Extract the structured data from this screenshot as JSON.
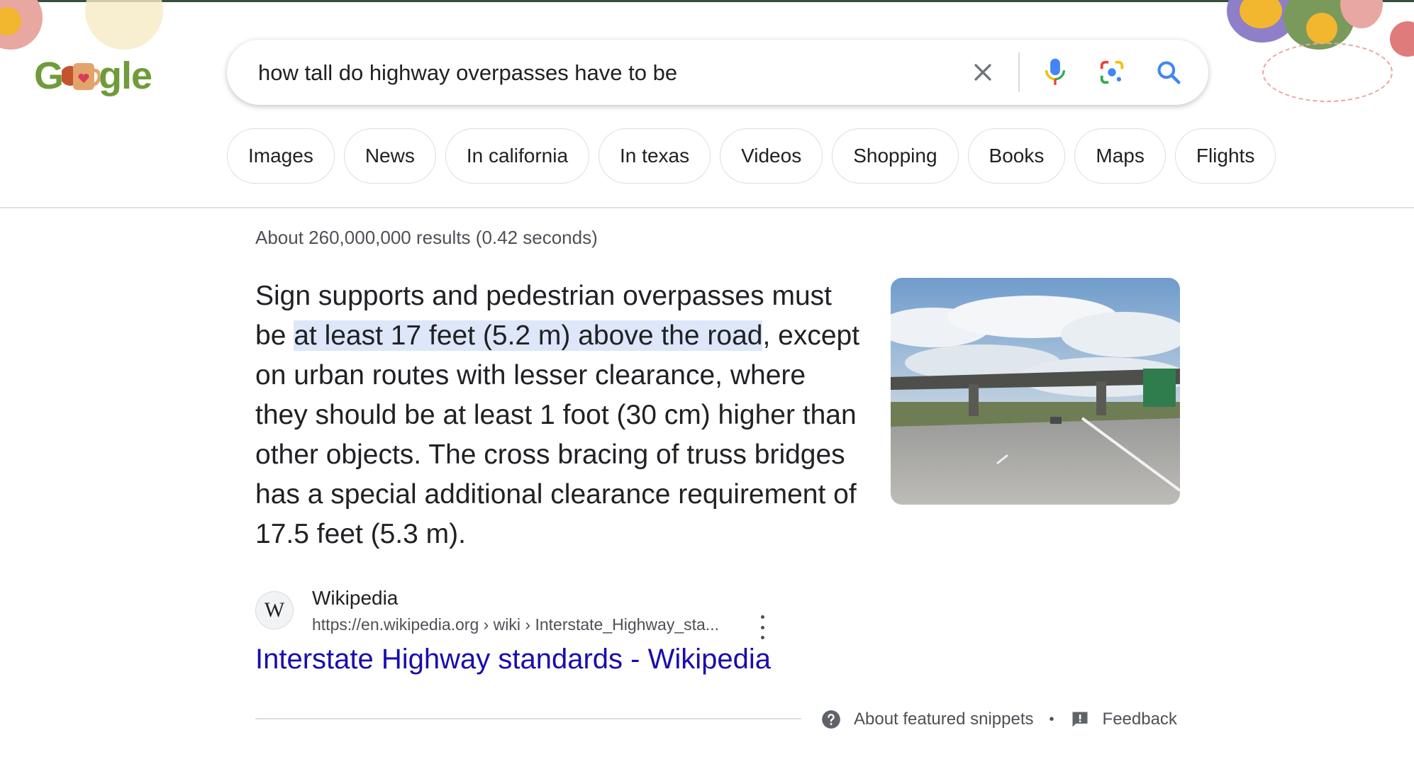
{
  "search": {
    "query": "how tall do highway overpasses have to be"
  },
  "icons": {
    "clear": "close-icon",
    "voice": "microphone-icon",
    "lens": "camera-lens-icon",
    "search": "search-icon",
    "help": "help-circle-icon",
    "feedback": "feedback-icon",
    "more": "more-vert-icon"
  },
  "chips": [
    "Images",
    "News",
    "In california",
    "In texas",
    "Videos",
    "Shopping",
    "Books",
    "Maps",
    "Flights"
  ],
  "results": {
    "stats": "About 260,000,000 results (0.42 seconds)"
  },
  "snippet": {
    "text_before": "Sign supports and pedestrian overpasses must be ",
    "text_highlight": "at least 17 feet (5.2 m) above the road",
    "text_after": ", except on urban routes with lesser clearance, where they should be at least 1 foot (30 cm) higher than other objects. The cross bracing of truss bridges has a special additional clearance requirement of 17.5 feet (5.3 m).",
    "image_alt": "highway overpass"
  },
  "source": {
    "favicon_letter": "W",
    "name": "Wikipedia",
    "url": "https://en.wikipedia.org › wiki › Interstate_Highway_sta...",
    "title": "Interstate Highway standards - Wikipedia"
  },
  "footer": {
    "about": "About featured snippets",
    "separator": "•",
    "feedback": "Feedback"
  },
  "colors": {
    "link": "#1a0dab",
    "highlight": "#dde7f9",
    "google_blue": "#4285f4",
    "google_red": "#ea4335",
    "google_yellow": "#fbbc04",
    "google_green": "#34a853"
  }
}
